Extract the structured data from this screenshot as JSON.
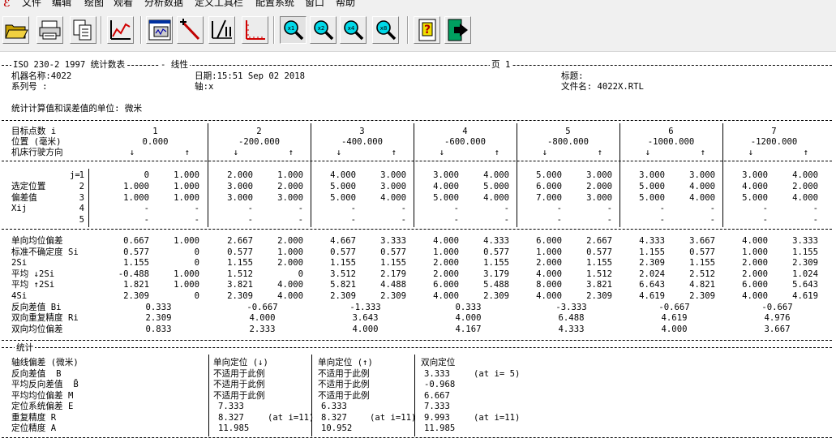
{
  "menu": [
    "文件",
    "编辑",
    "绘图",
    "观看",
    "分析数据",
    "定义工具栏",
    "配置系统",
    "窗口",
    "帮助"
  ],
  "toolbar": [
    "open-icon",
    "print-icon",
    "copy-icon",
    "line-chart-icon",
    "window-chart-icon",
    "marker-icon",
    "split-chart-icon",
    "axis-chart-icon",
    "zoom-x1-icon",
    "zoom-x2-icon",
    "zoom-x4-icon",
    "zoom-x8-icon",
    "help-icon",
    "exit-icon"
  ],
  "zoom_labels": [
    "x1",
    "x2",
    "x4",
    "x8"
  ],
  "report": {
    "standard": "ISO 230-2 1997 统计数表",
    "type_label": "- 线性",
    "page_label": "页 1",
    "machine_label": "机器名称:4022",
    "serial_label": "系列号 :",
    "date_label": "日期:15:51 Sep 02 2018",
    "axis_label": "轴:x",
    "title_label": "标题:",
    "file_label": "文件名: 4022X.RTL",
    "unit_label": "统计计算值和误差值的单位: 微米",
    "target_label": "目标点数 i",
    "position_label": "位置 (毫米)",
    "direction_label": "机床行驶方向",
    "arrow_down": "↓",
    "arrow_up": "↑",
    "points": [
      "1",
      "2",
      "3",
      "4",
      "5",
      "6",
      "7"
    ],
    "positions": [
      "0.000",
      "-200.000",
      "-400.000",
      "-600.000",
      "-800.000",
      "-1000.000",
      "-1200.000"
    ],
    "dev_labels": [
      "选定位置",
      "偏差值",
      "Xij"
    ],
    "j_label": "j=",
    "j_values": [
      "1",
      "2",
      "3",
      "4",
      "5"
    ],
    "deviations": [
      [
        [
          "0",
          "1.000"
        ],
        [
          "2.000",
          "1.000"
        ],
        [
          "4.000",
          "3.000"
        ],
        [
          "3.000",
          "4.000"
        ],
        [
          "5.000",
          "3.000"
        ],
        [
          "3.000",
          "3.000"
        ],
        [
          "3.000",
          "4.000"
        ]
      ],
      [
        [
          "1.000",
          "1.000"
        ],
        [
          "3.000",
          "2.000"
        ],
        [
          "5.000",
          "3.000"
        ],
        [
          "4.000",
          "5.000"
        ],
        [
          "6.000",
          "2.000"
        ],
        [
          "5.000",
          "4.000"
        ],
        [
          "4.000",
          "2.000"
        ]
      ],
      [
        [
          "1.000",
          "1.000"
        ],
        [
          "3.000",
          "3.000"
        ],
        [
          "5.000",
          "4.000"
        ],
        [
          "5.000",
          "4.000"
        ],
        [
          "7.000",
          "3.000"
        ],
        [
          "5.000",
          "4.000"
        ],
        [
          "5.000",
          "4.000"
        ]
      ],
      [
        [
          "-",
          "-"
        ],
        [
          "-",
          "-"
        ],
        [
          "-",
          "-"
        ],
        [
          "-",
          "-"
        ],
        [
          "-",
          "-"
        ],
        [
          "-",
          "-"
        ],
        [
          "-",
          "-"
        ]
      ],
      [
        [
          "-",
          "-"
        ],
        [
          "-",
          "-"
        ],
        [
          "-",
          "-"
        ],
        [
          "-",
          "-"
        ],
        [
          "-",
          "-"
        ],
        [
          "-",
          "-"
        ],
        [
          "-",
          "-"
        ]
      ]
    ],
    "stat_rows": [
      {
        "label": "单向均位偏差",
        "values": [
          [
            "0.667",
            "1.000"
          ],
          [
            "2.667",
            "2.000"
          ],
          [
            "4.667",
            "3.333"
          ],
          [
            "4.000",
            "4.333"
          ],
          [
            "6.000",
            "2.667"
          ],
          [
            "4.333",
            "3.667"
          ],
          [
            "4.000",
            "3.333"
          ]
        ]
      },
      {
        "label": "标准不确定度 Si",
        "values": [
          [
            "0.577",
            "0"
          ],
          [
            "0.577",
            "1.000"
          ],
          [
            "0.577",
            "0.577"
          ],
          [
            "1.000",
            "0.577"
          ],
          [
            "1.000",
            "0.577"
          ],
          [
            "1.155",
            "0.577"
          ],
          [
            "1.000",
            "1.155"
          ]
        ]
      },
      {
        "label": "2Si",
        "values": [
          [
            "1.155",
            "0"
          ],
          [
            "1.155",
            "2.000"
          ],
          [
            "1.155",
            "1.155"
          ],
          [
            "2.000",
            "1.155"
          ],
          [
            "2.000",
            "1.155"
          ],
          [
            "2.309",
            "1.155"
          ],
          [
            "2.000",
            "2.309"
          ]
        ]
      },
      {
        "label": "平均 ↓2Si",
        "values": [
          [
            "-0.488",
            "1.000"
          ],
          [
            "1.512",
            "0"
          ],
          [
            "3.512",
            "2.179"
          ],
          [
            "2.000",
            "3.179"
          ],
          [
            "4.000",
            "1.512"
          ],
          [
            "2.024",
            "2.512"
          ],
          [
            "2.000",
            "1.024"
          ]
        ]
      },
      {
        "label": "平均 ↑2Si",
        "values": [
          [
            "1.821",
            "1.000"
          ],
          [
            "3.821",
            "4.000"
          ],
          [
            "5.821",
            "4.488"
          ],
          [
            "6.000",
            "5.488"
          ],
          [
            "8.000",
            "3.821"
          ],
          [
            "6.643",
            "4.821"
          ],
          [
            "6.000",
            "5.643"
          ]
        ]
      },
      {
        "label": "4Si",
        "values": [
          [
            "2.309",
            "0"
          ],
          [
            "2.309",
            "4.000"
          ],
          [
            "2.309",
            "2.309"
          ],
          [
            "4.000",
            "2.309"
          ],
          [
            "4.000",
            "2.309"
          ],
          [
            "4.619",
            "2.309"
          ],
          [
            "4.000",
            "4.619"
          ]
        ]
      }
    ],
    "single_rows": [
      {
        "label": "反向差值 Bi",
        "values": [
          "0.333",
          "-0.667",
          "-1.333",
          "0.333",
          "-3.333",
          "-0.667",
          "-0.667"
        ]
      },
      {
        "label": "双向重复精度 Ri",
        "values": [
          "2.309",
          "4.000",
          "3.643",
          "4.000",
          "6.488",
          "4.619",
          "4.976"
        ]
      },
      {
        "label": "双向均位偏差",
        "values": [
          "0.833",
          "2.333",
          "4.000",
          "4.167",
          "4.333",
          "4.000",
          "3.667"
        ]
      }
    ],
    "stats_header": "统计",
    "stats_axis_label": "轴线偏差 (微米)",
    "stats_col_headers": [
      "单向定位 (↓)",
      "单向定位 (↑)",
      "双向定位"
    ],
    "stats_rows": [
      {
        "label": "反向差值  B",
        "c1": "不适用于此例",
        "c2": "不适用于此例",
        "c3": "3.333",
        "c3_note": "(at i= 5)"
      },
      {
        "label": "平均反向差值  B̄",
        "c1": "不适用于此例",
        "c2": "不适用于此例",
        "c3": "-0.968",
        "c3_note": ""
      },
      {
        "label": "平均均位偏差 M",
        "c1": "不适用于此例",
        "c2": "不适用于此例",
        "c3": "6.667",
        "c3_note": ""
      },
      {
        "label": "定位系统偏差 E",
        "c1": "7.333",
        "c2": "6.333",
        "c3": "7.333",
        "c3_note": ""
      },
      {
        "label": "重复精度 R",
        "c1": "8.327",
        "c1_note": "(at i=11)",
        "c2": "8.327",
        "c2_note": "(at i=11)",
        "c3": "9.993",
        "c3_note": "(at i=11)"
      },
      {
        "label": "定位精度 A",
        "c1": "11.985",
        "c2": "10.952",
        "c3": "11.985",
        "c3_note": ""
      }
    ]
  }
}
